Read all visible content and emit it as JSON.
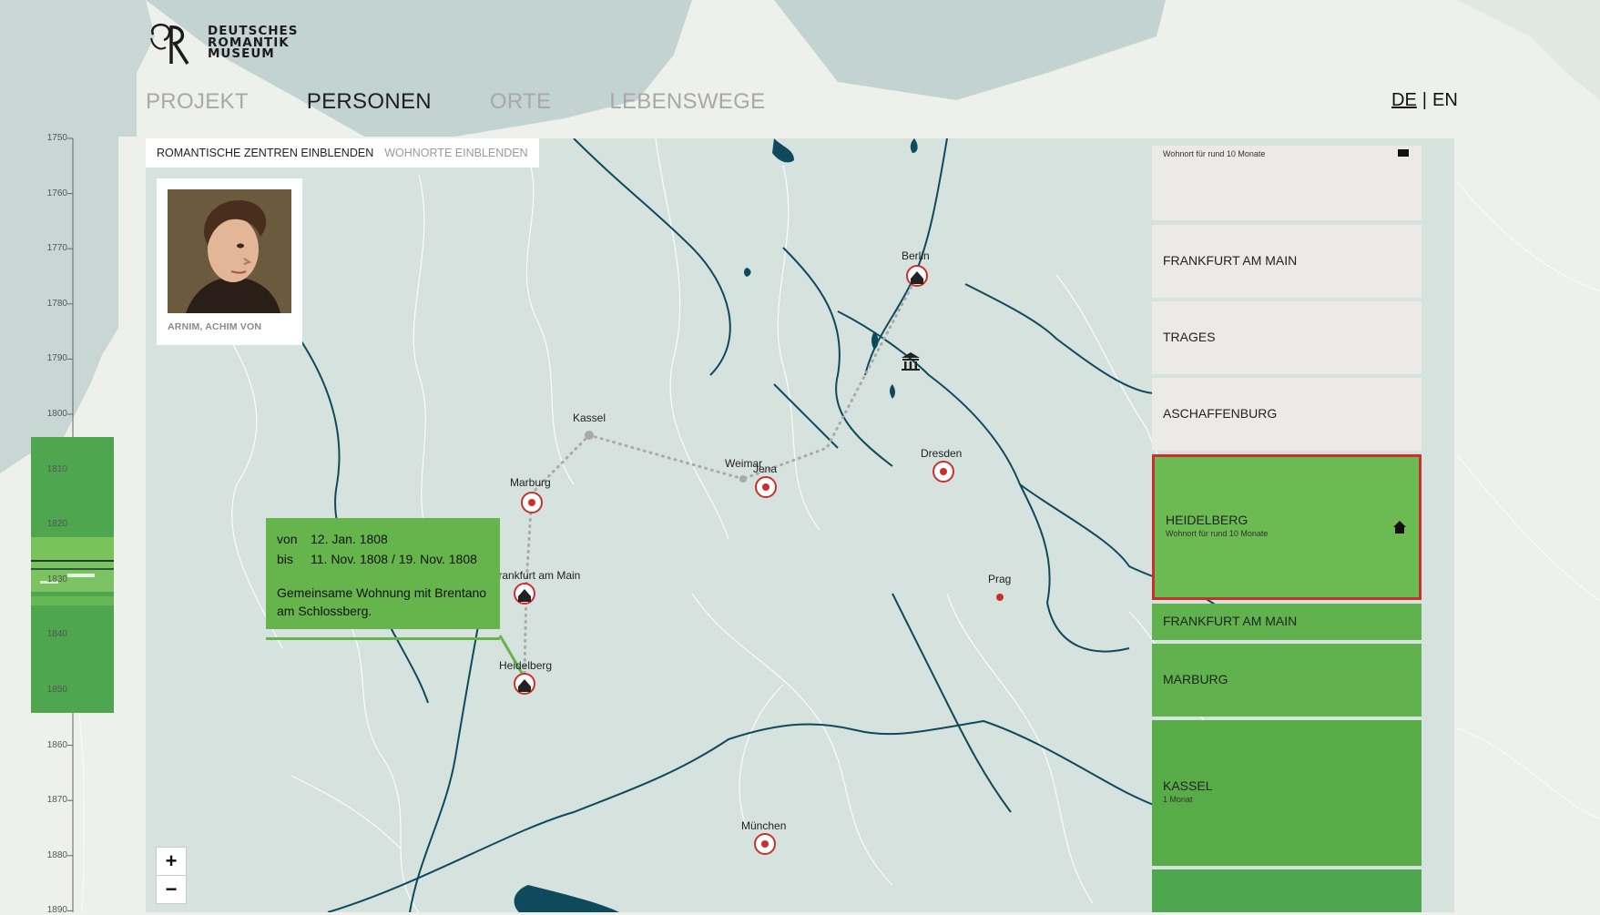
{
  "brand": {
    "logo_letter": "R",
    "name_line1": "DEUTSCHES",
    "name_line2": "ROMANTIK",
    "name_line3": "MUSEUM"
  },
  "nav": {
    "items": [
      {
        "label": "PROJEKT",
        "active": false
      },
      {
        "label": "PERSONEN",
        "active": true
      },
      {
        "label": "ORTE",
        "active": false
      },
      {
        "label": "LEBENSWEGE",
        "active": false
      }
    ]
  },
  "lang": {
    "de": "DE",
    "sep": "|",
    "en": "EN"
  },
  "toggles": {
    "centers": "ROMANTISCHE ZENTREN EINBLENDEN",
    "residences": "WOHNORTE EINBLENDEN"
  },
  "person": {
    "name": "ARNIM, ACHIM VON"
  },
  "popup": {
    "from_label": "von",
    "from_value": "12. Jan. 1808",
    "to_label": "bis",
    "to_value": "11. Nov. 1808 / 19. Nov. 1808",
    "note": "Gemeinsame Wohnung mit Brentano am Schlossberg."
  },
  "zoom": {
    "in": "+",
    "out": "−"
  },
  "timeline": {
    "years": [
      "1750",
      "1760",
      "1770",
      "1780",
      "1790",
      "1800",
      "1810",
      "1820",
      "1830",
      "1840",
      "1850",
      "1860",
      "1870",
      "1880",
      "1890"
    ]
  },
  "cities": {
    "berlin": "Berlin",
    "kassel": "Kassel",
    "marburg": "Marburg",
    "weimar": "Weimar",
    "jena": "Jena",
    "dresden": "Dresden",
    "frankfurt": "Frankfurt am Main",
    "prag": "Prag",
    "heidelberg": "Heidelberg",
    "muenchen": "München"
  },
  "panel": {
    "top_sub": "Wohnort für rund 10 Monate",
    "cards": [
      {
        "label": "FRANKFURT AM MAIN",
        "sub": ""
      },
      {
        "label": "TRAGES",
        "sub": ""
      },
      {
        "label": "ASCHAFFENBURG",
        "sub": ""
      },
      {
        "label": "HEIDELBERG",
        "sub": "Wohnort für rund 10 Monate"
      },
      {
        "label": "FRANKFURT AM MAIN",
        "sub": ""
      },
      {
        "label": "MARBURG",
        "sub": ""
      },
      {
        "label": "KASSEL",
        "sub": "1 Monat"
      }
    ]
  },
  "colors": {
    "accent_red": "#c9302c",
    "green": "#5fb24d",
    "map_water": "#0f4a5c",
    "map_land": "#d5e2dd"
  }
}
